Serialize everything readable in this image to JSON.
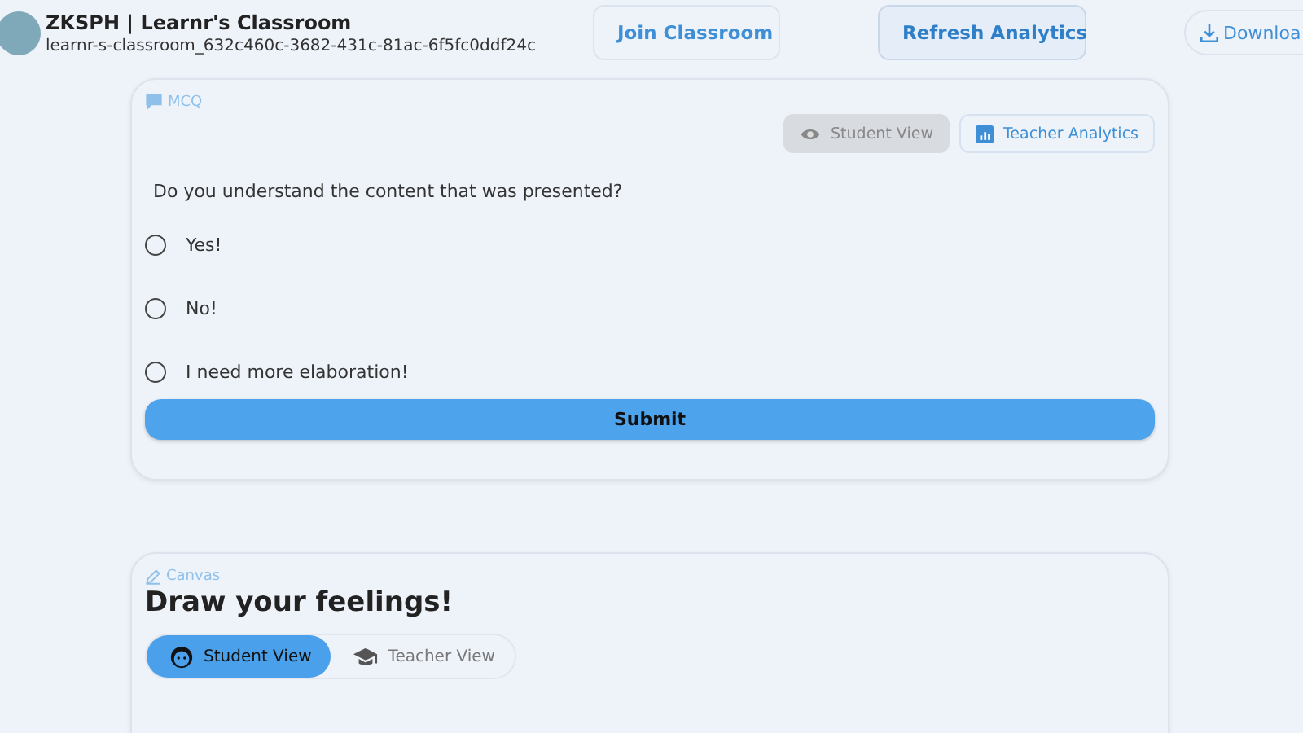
{
  "header": {
    "title": "ZKSPH | Learnr's Classroom",
    "subtitle": "learnr-s-classroom_632c460c-3682-431c-81ac-6f5fc0ddf24c",
    "buttons": [
      {
        "label": "Join Classroom",
        "kind": "join",
        "highlighted": false
      },
      {
        "label": "Refresh Analytics",
        "kind": "analytics",
        "highlighted": true
      },
      {
        "label": "Downloa",
        "kind": "download",
        "highlighted": false
      }
    ]
  },
  "mcq": {
    "tag": "MCQ",
    "views": [
      {
        "label": "Student View",
        "kind": "eye",
        "selected": true
      },
      {
        "label": "Teacher Analytics",
        "kind": "chart",
        "selected": false
      }
    ],
    "question": "Do you understand the content that was presented?",
    "options": [
      {
        "label": "Yes!",
        "selected": false
      },
      {
        "label": "No!",
        "selected": false
      },
      {
        "label": "I need more elaboration!",
        "selected": false
      }
    ],
    "submit": "Submit"
  },
  "canvas": {
    "tag": "Canvas",
    "title": "Draw your feelings!",
    "views": [
      {
        "label": "Student View",
        "kind": "face",
        "selected": true
      },
      {
        "label": "Teacher View",
        "kind": "cap",
        "selected": false
      }
    ]
  }
}
